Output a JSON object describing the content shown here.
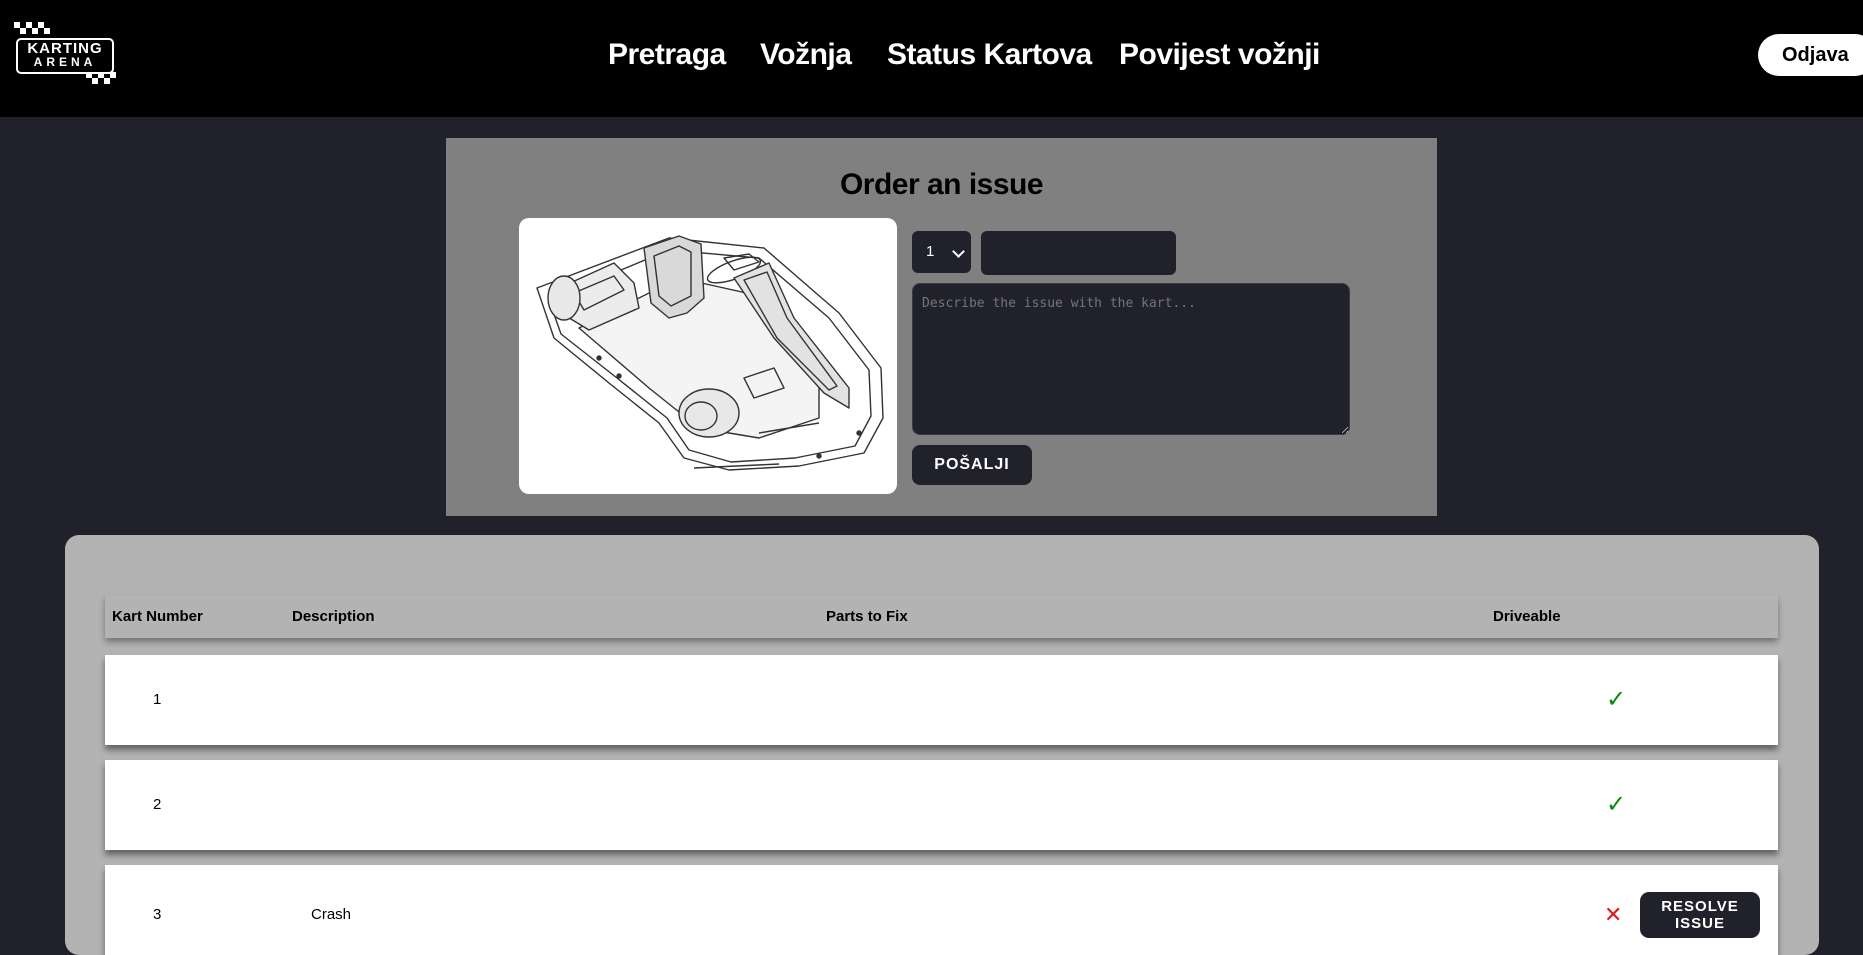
{
  "header": {
    "logo": {
      "line1": "KARTING",
      "line2": "ARENA"
    },
    "nav": [
      {
        "label": "Pretraga"
      },
      {
        "label": "Vožnja"
      },
      {
        "label": "Status Kartova"
      },
      {
        "label": "Povijest vožnji"
      }
    ],
    "logout_label": "Odjava"
  },
  "order": {
    "title": "Order an issue",
    "kart_select_value": "1",
    "parts_value": "",
    "description_placeholder": "Describe the issue with the kart...",
    "submit_label": "POŠALJI"
  },
  "issues_table": {
    "columns": [
      "Kart Number",
      "Description",
      "Parts to Fix",
      "Driveable"
    ],
    "rows": [
      {
        "kart_number": "1",
        "description": "",
        "parts": "",
        "driveable": "✓"
      },
      {
        "kart_number": "2",
        "description": "",
        "parts": "",
        "driveable": "✓"
      },
      {
        "kart_number": "3",
        "description": "Crash",
        "parts": "",
        "driveable": "✕",
        "action_label": "RESOLVE ISSUE"
      }
    ]
  },
  "colors": {
    "header_bg": "#000000",
    "page_bg": "#21212b",
    "order_panel_bg": "#808080",
    "table_panel_bg": "#b3b3b3",
    "driveable_yes": "#0a8a0a",
    "driveable_no": "#e01818"
  }
}
